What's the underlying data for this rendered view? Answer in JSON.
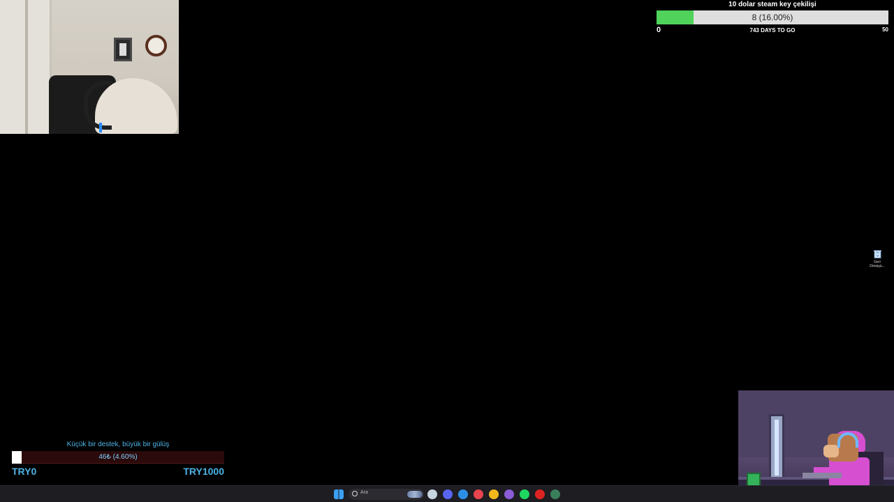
{
  "goal_top": {
    "title": "10 dolar steam key çekilişi",
    "bar_label": "8 (16.00%)",
    "progress_fraction": 0.16,
    "min_label": "0",
    "days_label": "743 DAYS TO GO",
    "max_label": "50",
    "colors": {
      "fill": "#4fd35a",
      "track": "#dedede"
    }
  },
  "desktop": {
    "recycle_bin_label": "Geri Dönüşü..."
  },
  "goal_donation": {
    "title": "Küçük bir destek, büyük bir gülüş",
    "bar_label": "46₺ (4.60%)",
    "progress_fraction": 0.046,
    "min_label": "TRY0",
    "max_label": "TRY1000",
    "colors": {
      "text": "#4db3e6",
      "fill": "#ffffff",
      "track": "#2a0a0a"
    }
  },
  "taskbar": {
    "search_placeholder": "Ara",
    "apps": [
      {
        "icon": "windows-start-icon",
        "color": "#3aa0f5"
      },
      {
        "icon": "steam-icon",
        "color": "#c7d5e0"
      },
      {
        "icon": "discord-icon",
        "color": "#5865f2"
      },
      {
        "icon": "vscode-icon",
        "color": "#2c8fe6"
      },
      {
        "icon": "snipping-icon",
        "color": "#e8444d"
      },
      {
        "icon": "chrome-icon",
        "color": "#f2b71b"
      },
      {
        "icon": "visual-studio-icon",
        "color": "#8a5cd6"
      },
      {
        "icon": "spotify-icon",
        "color": "#1ed760"
      },
      {
        "icon": "obs-icon",
        "color": "#d22"
      },
      {
        "icon": "terminal-icon",
        "color": "#3a7f5a"
      }
    ]
  }
}
